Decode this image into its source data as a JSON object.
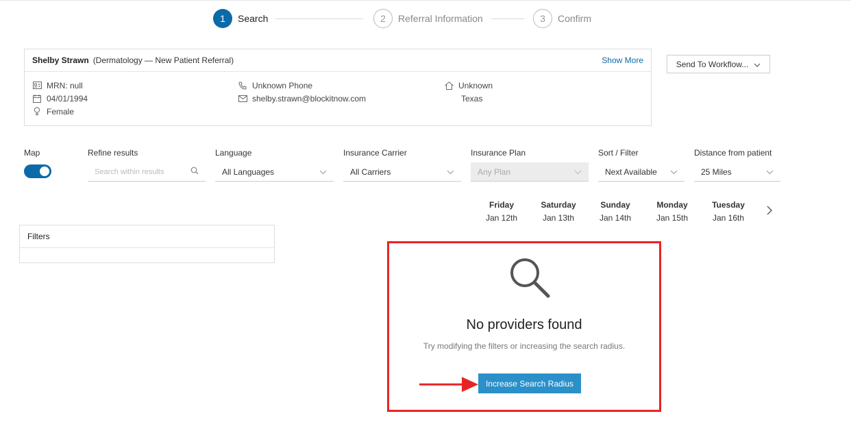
{
  "stepper": [
    {
      "number": "1",
      "label": "Search",
      "state": "active"
    },
    {
      "number": "2",
      "label": "Referral Information",
      "state": "inactive"
    },
    {
      "number": "3",
      "label": "Confirm",
      "state": "inactive"
    }
  ],
  "patient": {
    "name": "Shelby Strawn",
    "description": "(Dermatology — New Patient Referral)",
    "show_more": "Show More",
    "mrn": "MRN: null",
    "dob": "04/01/1994",
    "gender": "Female",
    "phone": "Unknown Phone",
    "email": "shelby.strawn@blockitnow.com",
    "address_line1": "Unknown",
    "address_line2": "Texas"
  },
  "workflow_button": "Send To Workflow...",
  "filters_row": {
    "map_label": "Map",
    "refine_label": "Refine results",
    "refine_placeholder": "Search within results",
    "language_label": "Language",
    "language_value": "All Languages",
    "carrier_label": "Insurance Carrier",
    "carrier_value": "All Carriers",
    "plan_label": "Insurance Plan",
    "plan_value": "Any Plan",
    "sort_label": "Sort / Filter",
    "sort_value": "Next Available",
    "distance_label": "Distance from patient",
    "distance_value": "25 Miles"
  },
  "days": [
    {
      "name": "Friday",
      "date": "Jan 12th"
    },
    {
      "name": "Saturday",
      "date": "Jan 13th"
    },
    {
      "name": "Sunday",
      "date": "Jan 14th"
    },
    {
      "name": "Monday",
      "date": "Jan 15th"
    },
    {
      "name": "Tuesday",
      "date": "Jan 16th"
    }
  ],
  "filters_panel": {
    "title": "Filters"
  },
  "empty_state": {
    "title": "No providers found",
    "subtitle": "Try modifying the filters or increasing the search radius.",
    "button": "Increase Search Radius"
  },
  "colors": {
    "primary": "#0b6aa8",
    "button": "#2b90c9",
    "highlight": "#e62424"
  }
}
